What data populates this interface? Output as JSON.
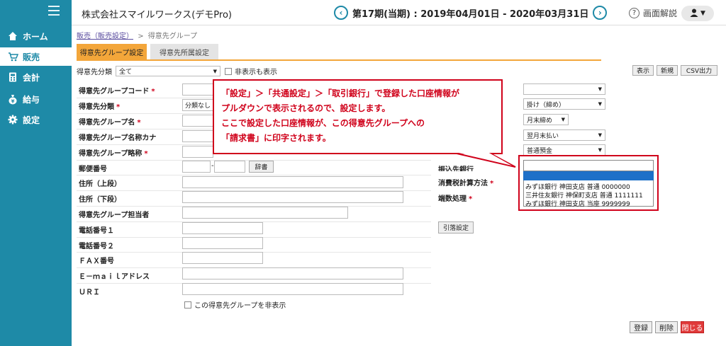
{
  "sidebar": {
    "items": [
      {
        "label": "ホーム",
        "icon": "home-icon"
      },
      {
        "label": "販売",
        "icon": "cart-icon"
      },
      {
        "label": "会計",
        "icon": "calculator-icon"
      },
      {
        "label": "給与",
        "icon": "money-bag-icon"
      },
      {
        "label": "設定",
        "icon": "gear-icon"
      }
    ]
  },
  "header": {
    "company": "株式会社スマイルワークス(デモPro)",
    "period": "第17期(当期) : 2019年04月01日 - 2020年03月31日",
    "help_label": "画面解説"
  },
  "breadcrumb": {
    "link": "販売（販売設定）",
    "sep": ">",
    "current": "得意先グループ"
  },
  "tabs": [
    {
      "label": "得意先グループ設定"
    },
    {
      "label": "得意先所属設定"
    }
  ],
  "filter": {
    "label": "得意先分類",
    "select_value": "全て",
    "checkbox_label": "非表示も表示",
    "buttons": [
      "表示",
      "新規",
      "CSV出力"
    ]
  },
  "form": {
    "left": [
      {
        "label": "得意先グループコード",
        "required": true
      },
      {
        "label": "得意先分類",
        "required": true,
        "value": "分類なし"
      },
      {
        "label": "得意先グループ名",
        "required": true
      },
      {
        "label": "得意先グループ名称カナ",
        "required": false
      },
      {
        "label": "得意先グループ略称",
        "required": true
      },
      {
        "label": "郵便番号",
        "required": false
      },
      {
        "label": "住所（上段）",
        "required": false
      },
      {
        "label": "住所（下段）",
        "required": false
      },
      {
        "label": "得意先グループ担当者",
        "required": false
      },
      {
        "label": "電話番号１",
        "required": false
      },
      {
        "label": "電話番号２",
        "required": false
      },
      {
        "label": "ＦＡＸ番号",
        "required": false
      },
      {
        "label": "Ｅ－ｍａｉｌアドレス",
        "required": false
      },
      {
        "label": "ＵＲＩ",
        "required": false
      }
    ],
    "zip_button": "辞書",
    "hide_checkbox_label": "この得意先グループを非表示",
    "right": [
      {
        "value": ""
      },
      {
        "value": "掛け（締め）"
      },
      {
        "value": "月末締め"
      },
      {
        "value": "翌月末払い"
      },
      {
        "value": "普通預金"
      }
    ],
    "right_labels": {
      "partial": "振込先銀行",
      "tax": "消費税計算方法",
      "rounding": "端数処理"
    },
    "bank_button": "引落設定"
  },
  "callout": {
    "lines": [
      "「設定」＞「共通設定」＞「取引銀行」で登録した口座情報が",
      "プルダウンで表示されるので、設定します。",
      "ここで設定した口座情報が、この得意先グループへの",
      "「請求書」に印字されます。"
    ]
  },
  "dropdown": {
    "options": [
      "みずほ銀行 神田支店 普通 0000000",
      "三井住友銀行 神保町支店 普通 1111111",
      "みずほ銀行 神田支店 当座 9999999"
    ]
  },
  "bottom_buttons": [
    "登録",
    "削除",
    "閉じる"
  ],
  "colors": {
    "sidebar": "#1e8aa7",
    "accent": "#f3a63a",
    "alert": "#d0021b"
  }
}
